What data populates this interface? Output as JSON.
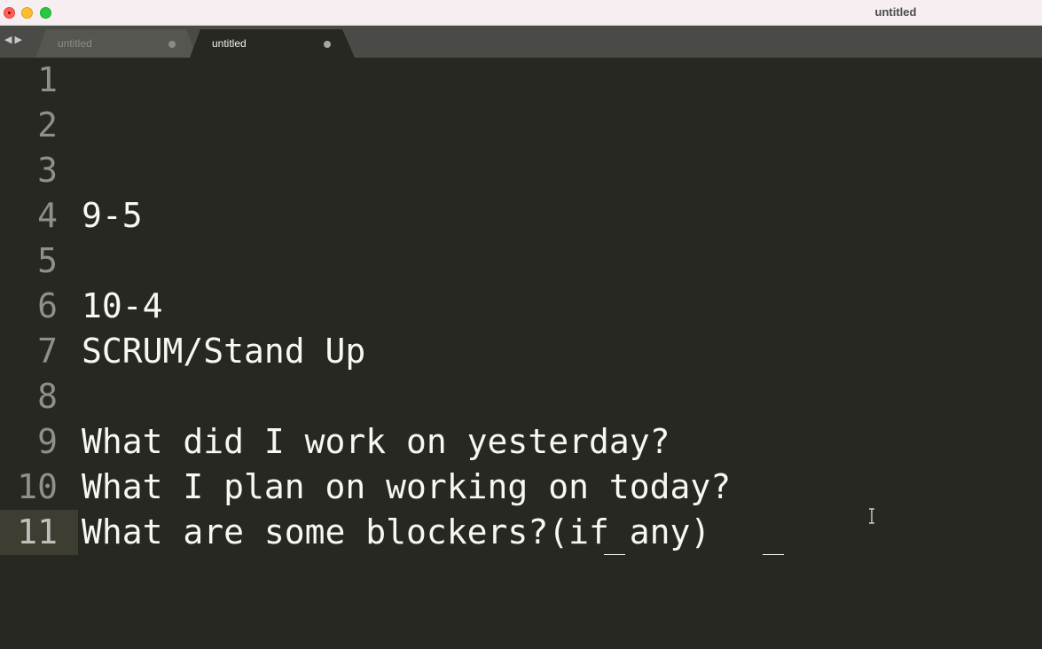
{
  "window": {
    "title": "untitled"
  },
  "tabs": [
    {
      "label": "untitled",
      "active": false,
      "modified": true
    },
    {
      "label": "untitled",
      "active": true,
      "modified": true
    }
  ],
  "nav": {
    "back_icon": "left-arrow-icon",
    "forward_icon": "right-arrow-icon"
  },
  "editor": {
    "current_line": 11,
    "lines": [
      {
        "number": "1",
        "text": ""
      },
      {
        "number": "2",
        "text": ""
      },
      {
        "number": "3",
        "text": ""
      },
      {
        "number": "4",
        "text": "9-5"
      },
      {
        "number": "5",
        "text": ""
      },
      {
        "number": "6",
        "text": "10-4"
      },
      {
        "number": "7",
        "text": "SCRUM/Stand Up"
      },
      {
        "number": "8",
        "text": ""
      },
      {
        "number": "9",
        "text": "What did I work on yesterday?"
      },
      {
        "number": "10",
        "text": "What I plan on working on today?"
      },
      {
        "number": "11",
        "text": "What are some blockers?(if any)"
      }
    ]
  },
  "colors": {
    "editor_bg": "#272822",
    "text": "#f8f8f2",
    "gutter_text": "#90908a",
    "tabbar_bg": "#4a4b47",
    "titlebar_bg": "#f6eef0"
  }
}
